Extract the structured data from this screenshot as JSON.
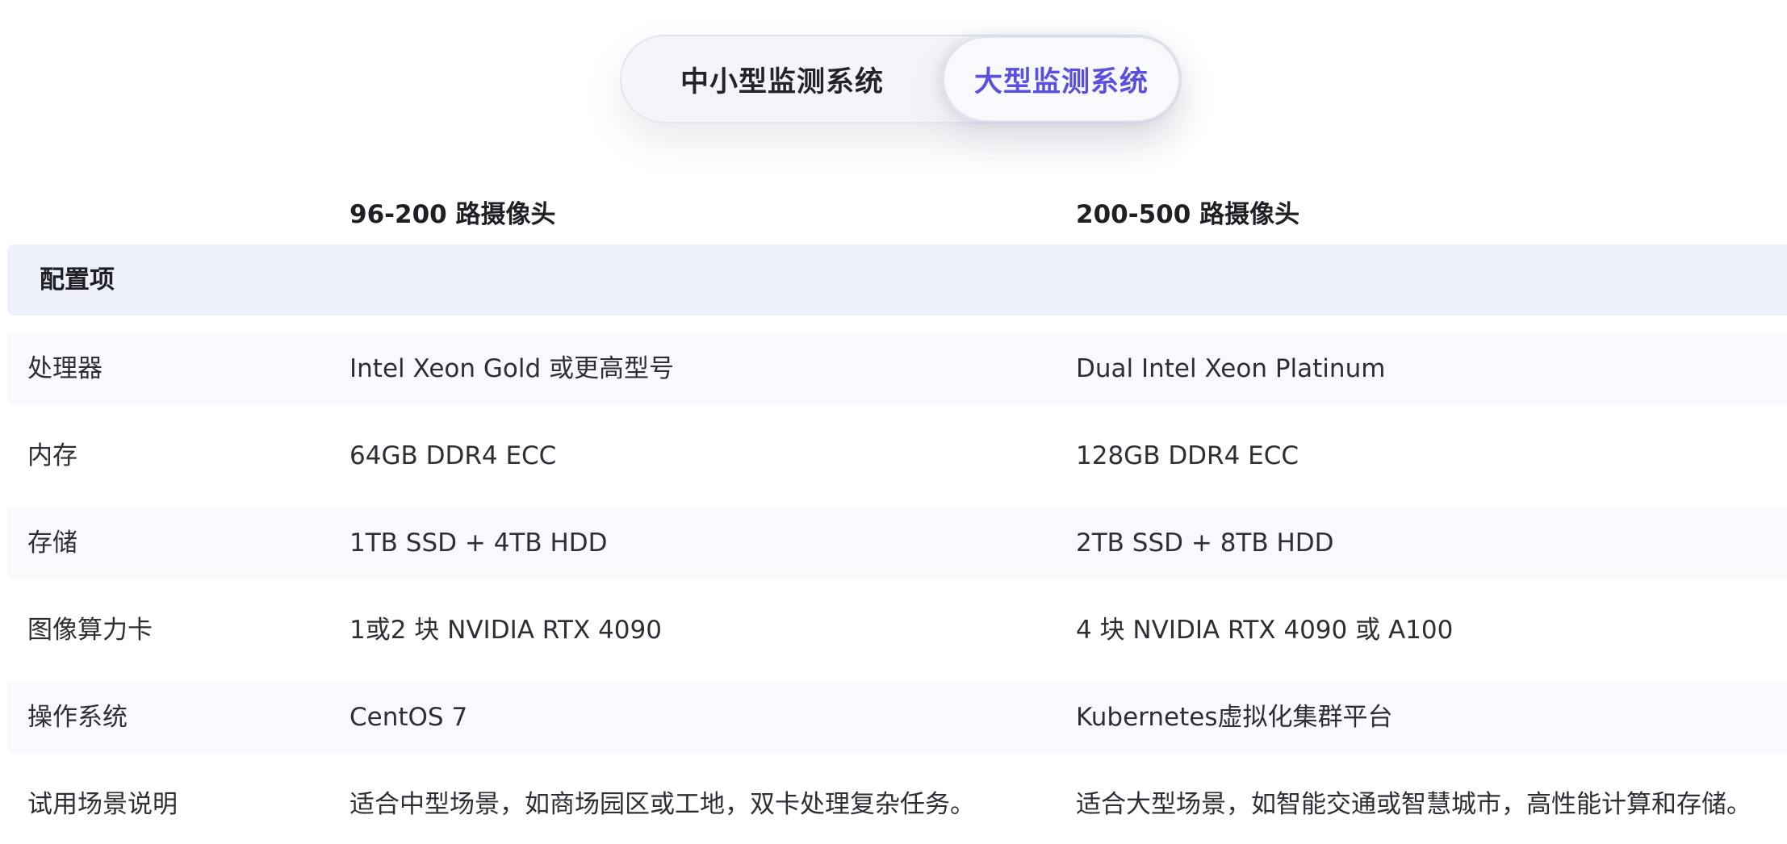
{
  "tabs": [
    {
      "label": "中小型监测系统",
      "active": false
    },
    {
      "label": "大型监测系统",
      "active": true
    }
  ],
  "columns": {
    "col1": "96-200 路摄像头",
    "col2": "200-500 路摄像头"
  },
  "section": {
    "label": "配置项"
  },
  "rows": [
    {
      "label": "处理器",
      "col1": "Intel Xeon Gold 或更高型号",
      "col2": "Dual Intel Xeon Platinum"
    },
    {
      "label": "内存",
      "col1": "64GB DDR4 ECC",
      "col2": "128GB DDR4 ECC"
    },
    {
      "label": "存储",
      "col1": "1TB SSD + 4TB HDD",
      "col2": "2TB SSD + 8TB HDD"
    },
    {
      "label": "图像算力卡",
      "col1": "1或2 块 NVIDIA RTX 4090",
      "col2": "4 块 NVIDIA RTX 4090 或 A100"
    },
    {
      "label": "操作系统",
      "col1": "CentOS 7",
      "col2": "Kubernetes虚拟化集群平台"
    },
    {
      "label": "试用场景说明",
      "col1": "适合中型场景，如商场园区或工地，双卡处理复杂任务。",
      "col2": "适合大型场景，如智能交通或智慧城市，高性能计算和存储。"
    }
  ],
  "colors": {
    "active_tab": "#5b4fe0",
    "band": "#eef1fa",
    "row_shade": "#f8f9fc"
  }
}
